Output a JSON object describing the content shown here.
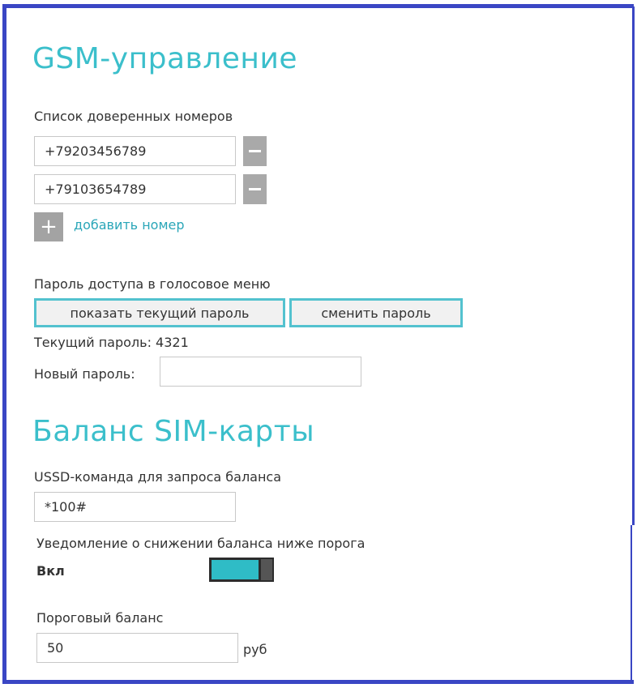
{
  "gsm": {
    "title": "GSM-управление",
    "trusted_label": "Список доверенных номеров",
    "numbers": [
      "+79203456789",
      "+79103654789"
    ],
    "add_number_label": "добавить номер",
    "password_section_label": "Пароль доступа в голосовое меню",
    "show_password_button": "показать текущий пароль",
    "change_password_button": "сменить пароль",
    "current_password_text": "Текущий пароль: 4321",
    "new_password_label": "Новый пароль:",
    "new_password_value": ""
  },
  "balance": {
    "title": "Баланс SIM-карты",
    "ussd_label": "USSD-команда для запроса баланса",
    "ussd_value": "*100#",
    "notify_label": "Уведомление о снижении баланса ниже порога",
    "toggle_state_label": "Вкл",
    "toggle_on": true,
    "threshold_label": "Пороговый баланс",
    "threshold_value": "50",
    "currency": "руб"
  },
  "colors": {
    "accent": "#3bbfcb",
    "frame": "#3a46c4",
    "button_border": "#53c2cf"
  },
  "icons": {
    "remove": "minus-icon",
    "add": "plus-icon"
  }
}
